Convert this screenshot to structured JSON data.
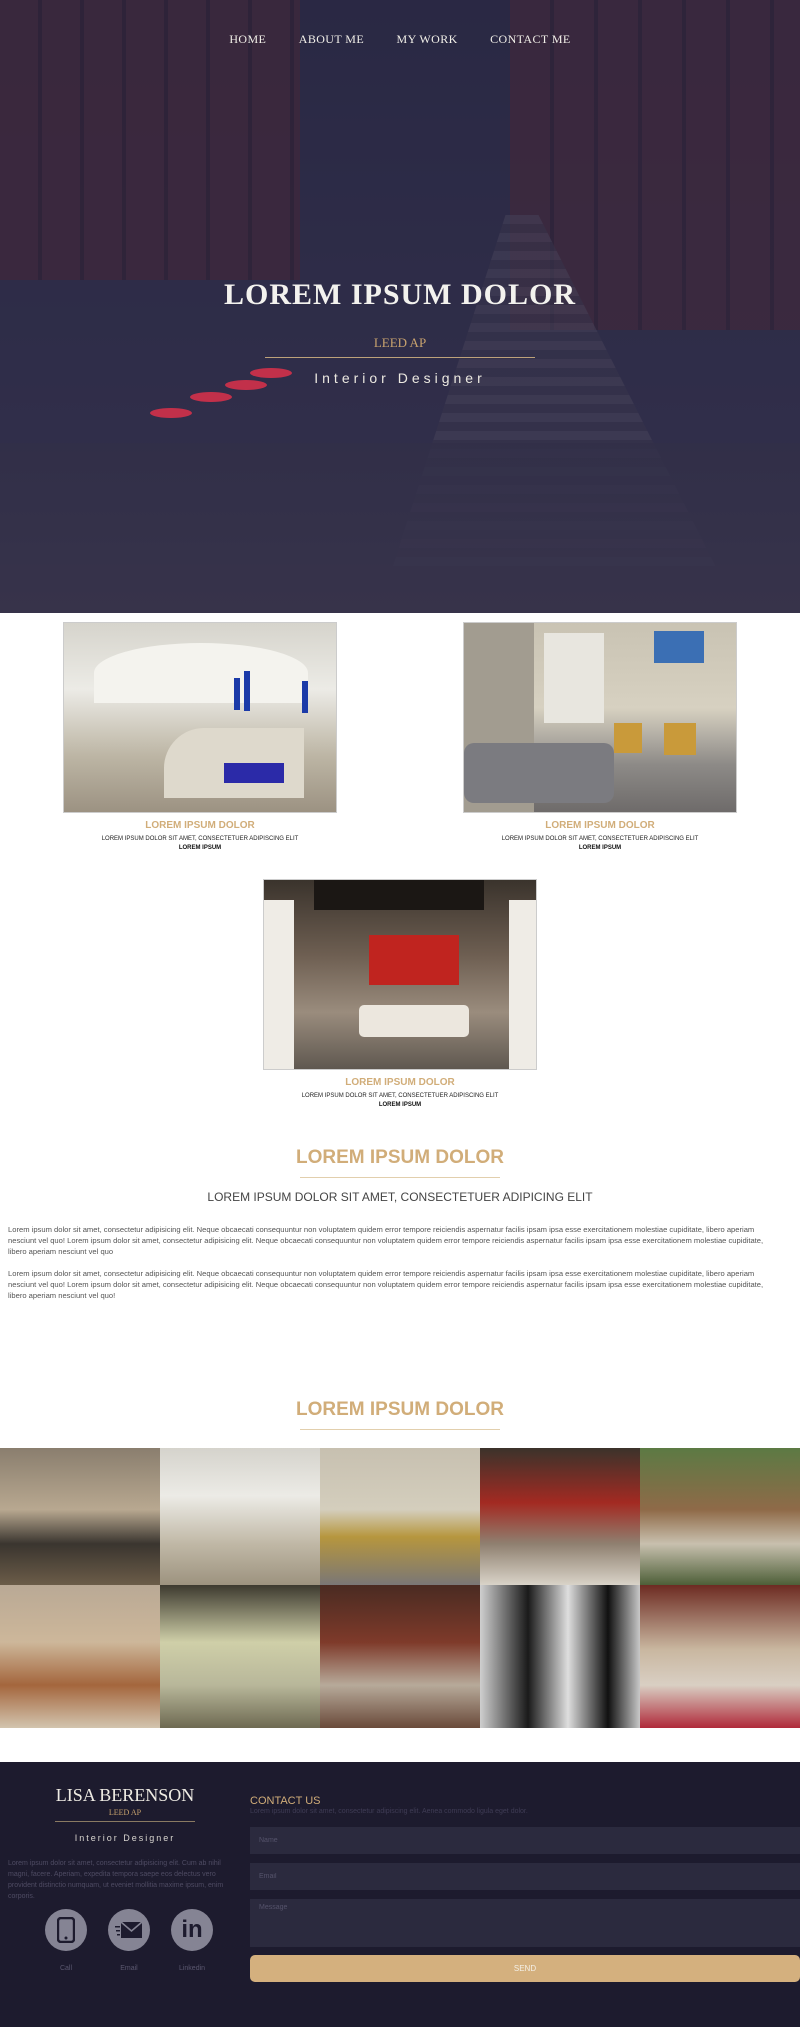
{
  "nav": {
    "items": [
      "HOME",
      "ABOUT ME",
      "MY WORK",
      "CONTACT ME"
    ]
  },
  "hero": {
    "title": "LOREM IPSUM DOLOR",
    "subtitle": "LEED AP",
    "role": "Interior Designer"
  },
  "projects": [
    {
      "title": "LOREM IPSUM DOLOR",
      "subtitle": "LOREM IPSUM DOLOR SIT AMET, CONSECTETUER ADIPISCING ELIT",
      "label": "LOREM IPSUM"
    },
    {
      "title": "LOREM IPSUM DOLOR",
      "subtitle": "LOREM IPSUM DOLOR SIT AMET, CONSECTETUER ADIPISCING ELIT",
      "label": "LOREM IPSUM"
    },
    {
      "title": "LOREM IPSUM DOLOR",
      "subtitle": "LOREM IPSUM DOLOR SIT AMET, CONSECTETUER ADIPISCING ELIT",
      "label": "LOREM IPSUM"
    }
  ],
  "about": {
    "title": "LOREM IPSUM DOLOR",
    "subtitle": "LOREM IPSUM DOLOR SIT AMET, CONSECTETUER ADIPICING ELIT",
    "paragraphs": [
      "Lorem ipsum dolor sit amet, consectetur adipisicing elit. Neque obcaecati consequuntur non voluptatem quidem error tempore reiciendis aspernatur facilis ipsam ipsa esse exercitationem molestiae cupiditate, libero aperiam nesciunt vel quo! Lorem ipsum dolor sit amet, consectetur adipisicing elit. Neque obcaecati consequuntur non voluptatem quidem error tempore reiciendis aspernatur facilis ipsam ipsa esse exercitationem molestiae cupiditate, libero aperiam nesciunt vel quo",
      "Lorem ipsum dolor sit amet, consectetur adipisicing elit. Neque obcaecati consequuntur non voluptatem quidem error tempore reiciendis aspernatur facilis ipsam ipsa esse exercitationem molestiae cupiditate, libero aperiam nesciunt vel quo! Lorem ipsum dolor sit amet, consectetur adipisicing elit. Neque obcaecati consequuntur non voluptatem quidem error tempore reiciendis aspernatur facilis ipsam ipsa esse exercitationem molestiae cupiditate, libero aperiam nesciunt vel quo!"
    ]
  },
  "gallery": {
    "title": "LOREM IPSUM DOLOR"
  },
  "footer": {
    "name": "LISA BERENSON",
    "leed": "LEED AP",
    "role": "Interior Designer",
    "about": "Lorem ipsum dolor sit amet, consectetur adipisicing elit. Cum ab nihil magni, facere. Aperiam, expedita tempora saepe eos delectus vero provident distinctio numquam, ut eveniet mollitia maxime ipsum, enim corporis.",
    "icons": [
      {
        "icon": "phone-icon",
        "label": "Call"
      },
      {
        "icon": "email-icon",
        "label": "Email"
      },
      {
        "icon": "linkedin-icon",
        "label": "Linkedin"
      }
    ],
    "contact": {
      "title": "CONTACT US",
      "text": "Lorem ipsum dolor sit amet, consectetur adipiscing elit. Aenea commodo ligula eget dolor.",
      "name_placeholder": "Name",
      "email_placeholder": "Email",
      "message_placeholder": "Message",
      "send_label": "SEND"
    }
  },
  "colors": {
    "accent": "#d1ad79",
    "footer_bg": "#1d1b2e",
    "hero_overlay": "#2d2c43"
  }
}
